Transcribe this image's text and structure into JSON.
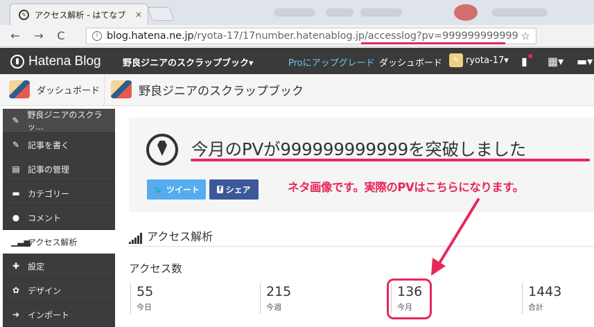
{
  "browser": {
    "tab_title": "アクセス解析 - はてなブ",
    "tab_close": "×",
    "url_host": "blog.hatena.ne.jp",
    "url_path": "/ryota-17/17number.hatenablog.jp/accesslog?pv=999999999999",
    "back": "←",
    "forward": "→",
    "reload": "C",
    "star": "☆"
  },
  "header": {
    "logo": "Hatena Blog",
    "blog_menu": "野良ジニアのスクラップブック▾",
    "upgrade": "Proにアップグレード",
    "dashboard": "ダッシュボード",
    "username": "ryota-17▾"
  },
  "subbar": {
    "dashboard": "ダッシュボード",
    "blog_title": "野良ジニアのスクラップブック"
  },
  "sidebar": {
    "items": [
      {
        "label": "野良ジニアのスクラッ…",
        "icon": "mascot-icon"
      },
      {
        "label": "記事を書く",
        "icon": "edit-icon"
      },
      {
        "label": "記事の管理",
        "icon": "document-icon"
      },
      {
        "label": "カテゴリー",
        "icon": "folder-icon"
      },
      {
        "label": "コメント",
        "icon": "comment-icon"
      },
      {
        "label": "アクセス解析",
        "icon": "bar-chart-icon"
      },
      {
        "label": "設定",
        "icon": "wrench-icon"
      },
      {
        "label": "デザイン",
        "icon": "palette-icon"
      },
      {
        "label": "インポート",
        "icon": "import-icon"
      }
    ]
  },
  "notice": {
    "text": "今月のPVが999999999999を突破しました",
    "tweet": "ツイート",
    "share": "シェア"
  },
  "annotation": {
    "callout": "ネタ画像です。実際のPVはこちらになります。",
    "color": "#e8275a"
  },
  "access": {
    "section_title": "アクセス解析",
    "heading": "アクセス数",
    "stats": [
      {
        "value": "55",
        "label": "今日"
      },
      {
        "value": "215",
        "label": "今週"
      },
      {
        "value": "136",
        "label": "今月"
      },
      {
        "value": "1443",
        "label": "合計"
      }
    ]
  }
}
